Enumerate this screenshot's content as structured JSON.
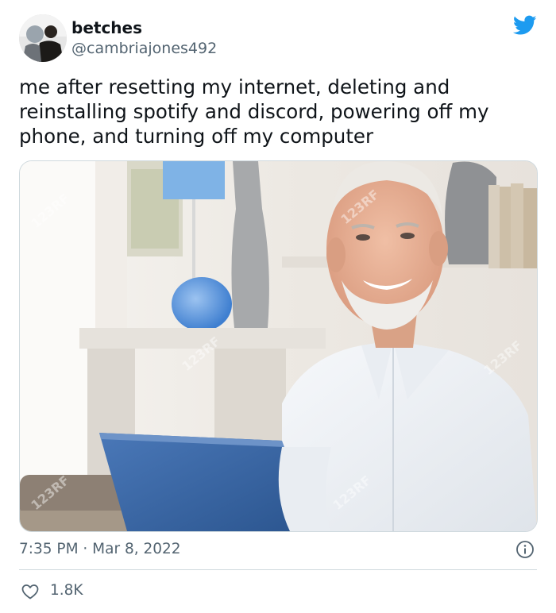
{
  "tweet": {
    "author_name": "betches",
    "author_handle": "@cambriajones492",
    "text": "me after resetting my internet, deleting and reinstalling spotify and discord, powering off my phone, and turning off my computer",
    "timestamp": "7:35 PM · Mar 8, 2022",
    "like_count": "1.8K"
  },
  "media": {
    "watermark_text": "123RF"
  },
  "icons": {
    "logo": "twitter-bird-icon",
    "info": "info-icon",
    "like": "heart-icon"
  },
  "colors": {
    "brand": "#1d9bf0",
    "secondary_text": "#536471",
    "divider": "#cfd9de"
  }
}
